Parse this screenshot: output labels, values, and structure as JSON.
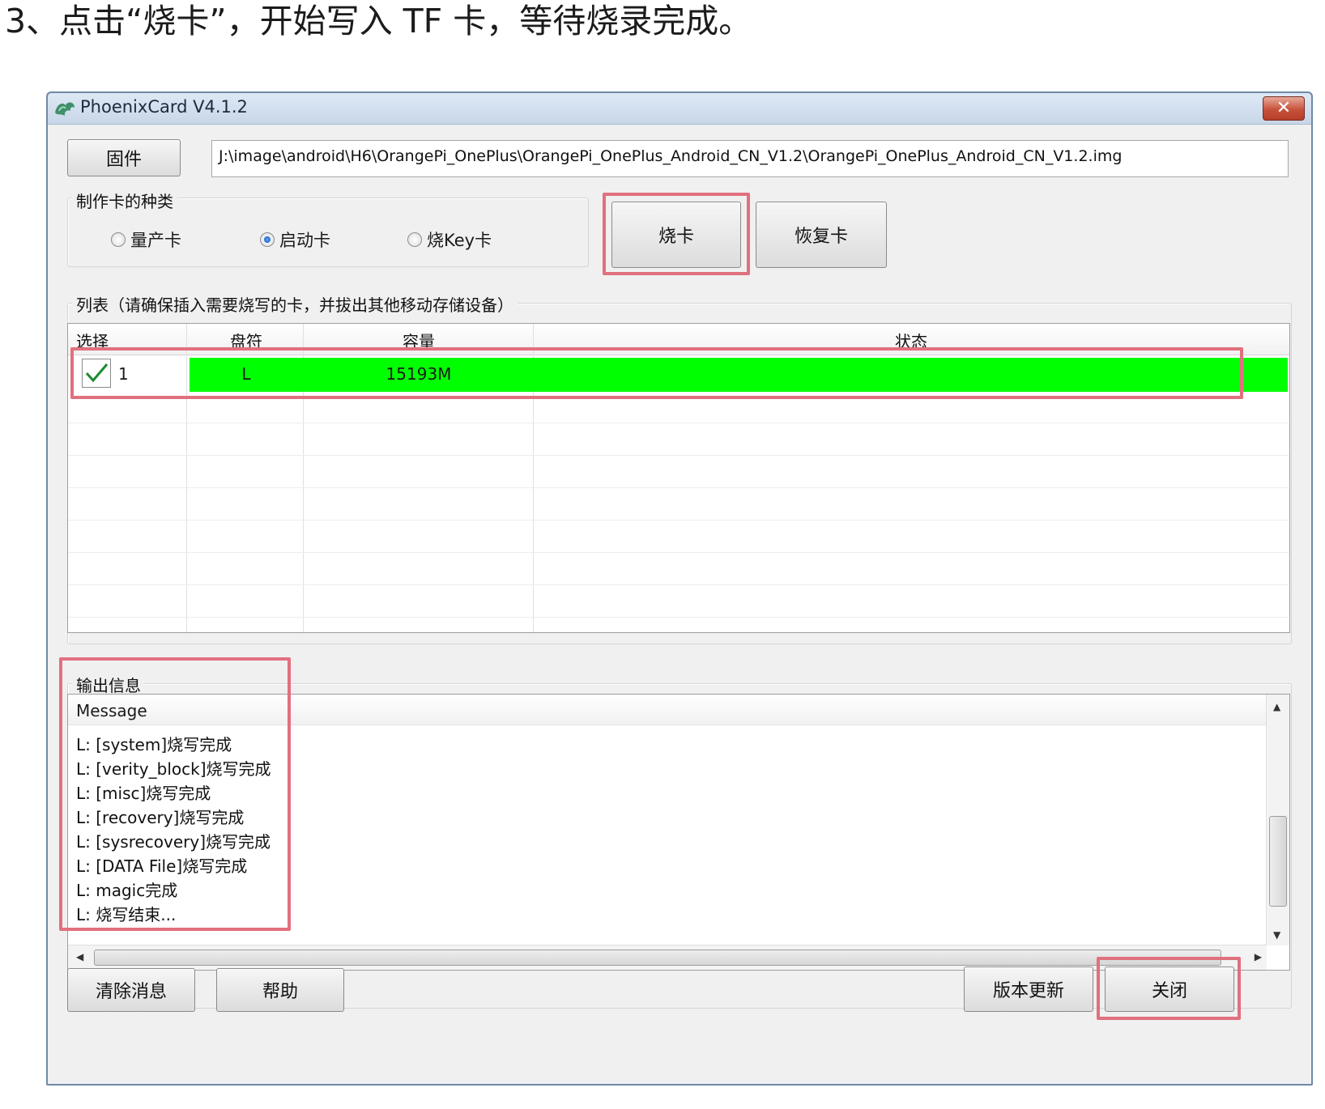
{
  "heading": "3、点击“烧卡”，开始写入 TF 卡，等待烧录完成。",
  "window": {
    "title": "PhoenixCard V4.1.2",
    "close_label": "✕"
  },
  "firmware": {
    "button_label": "固件",
    "path": "J:\\image\\android\\H6\\OrangePi_OnePlus\\OrangePi_OnePlus_Android_CN_V1.2\\OrangePi_OnePlus_Android_CN_V1.2.img"
  },
  "card_type": {
    "label": "制作卡的种类",
    "options": [
      {
        "label": "量产卡",
        "selected": false
      },
      {
        "label": "启动卡",
        "selected": true
      },
      {
        "label": "烧Key卡",
        "selected": false
      }
    ]
  },
  "actions": {
    "burn_label": "烧卡",
    "restore_label": "恢复卡"
  },
  "list": {
    "label": "列表（请确保插入需要烧写的卡，并拔出其他移动存储设备）",
    "columns": [
      "选择",
      "盘符",
      "容量",
      "状态"
    ],
    "rows": [
      {
        "index": "1",
        "checked": true,
        "drive": "L",
        "capacity": "15193M",
        "status": "",
        "status_color": "#00ff00"
      }
    ]
  },
  "output": {
    "label": "输出信息",
    "column": "Message",
    "messages": [
      "L: [system]烧写完成",
      "L: [verity_block]烧写完成",
      "L: [misc]烧写完成",
      "L: [recovery]烧写完成",
      "L: [sysrecovery]烧写完成",
      "L: [DATA File]烧写完成",
      "L: magic完成",
      "L: 烧写结束..."
    ]
  },
  "footer": {
    "clear_label": "清除消息",
    "help_label": "帮助",
    "update_label": "版本更新",
    "close_label": "关闭"
  },
  "colors": {
    "highlight": "#e1707e",
    "status_green": "#00ff00"
  }
}
